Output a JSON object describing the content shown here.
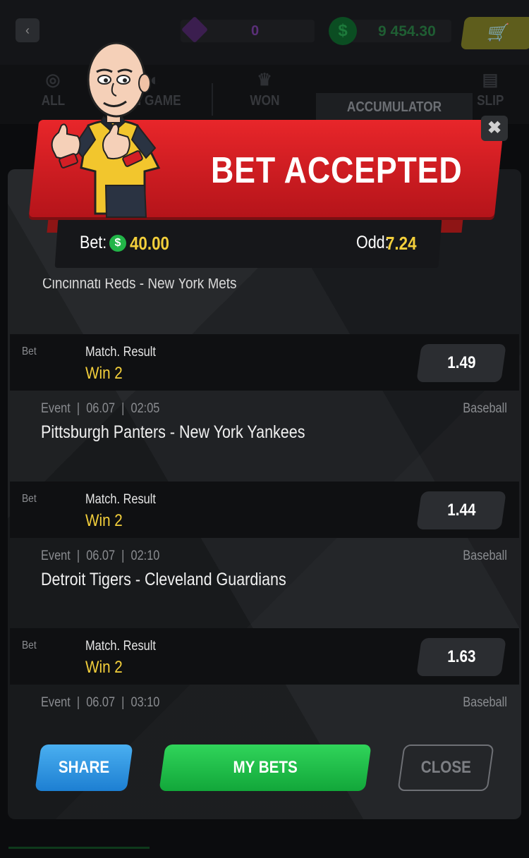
{
  "header": {
    "back_icon": "chevron-left-icon",
    "gems": "0",
    "coins": "9 454.30",
    "cart_icon": "cart-icon"
  },
  "tabs": [
    {
      "label": "ALL"
    },
    {
      "label": "IN GAME"
    },
    {
      "label": "WON"
    },
    {
      "label": "ACCUMULATOR"
    },
    {
      "label": "SLIP"
    }
  ],
  "banner": {
    "title": "BET ACCEPTED",
    "bet_label": "Bet:",
    "bet_value": "40.00",
    "odd_label": "Odd:",
    "odd_value": "7.24",
    "coin_symbol": "$",
    "close_symbol": "✖"
  },
  "partial_event": "Cincinnati Reds - New York Mets",
  "bets": [
    {
      "bet_label": "Bet",
      "market": "Match. Result",
      "pick": "Win 2",
      "odd": "1.49",
      "event_label": "Event",
      "date": "06.07",
      "time": "02:05",
      "sport": "Baseball",
      "event": "Pittsburgh Panters - New York Yankees"
    },
    {
      "bet_label": "Bet",
      "market": "Match. Result",
      "pick": "Win 2",
      "odd": "1.44",
      "event_label": "Event",
      "date": "06.07",
      "time": "02:10",
      "sport": "Baseball",
      "event": "Detroit Tigers - Cleveland Guardians"
    },
    {
      "bet_label": "Bet",
      "market": "Match. Result",
      "pick": "Win 2",
      "odd": "1.63",
      "event_label": "Event",
      "date": "06.07",
      "time": "03:10",
      "sport": "Baseball",
      "event": ""
    }
  ],
  "actions": {
    "share": "SHARE",
    "my_bets": "MY BETS",
    "close": "CLOSE"
  },
  "colors": {
    "accent_yellow": "#f3cf3b",
    "banner_red": "#d81e22",
    "share_blue": "#2a8fe0",
    "mybets_green": "#1fbf48"
  }
}
